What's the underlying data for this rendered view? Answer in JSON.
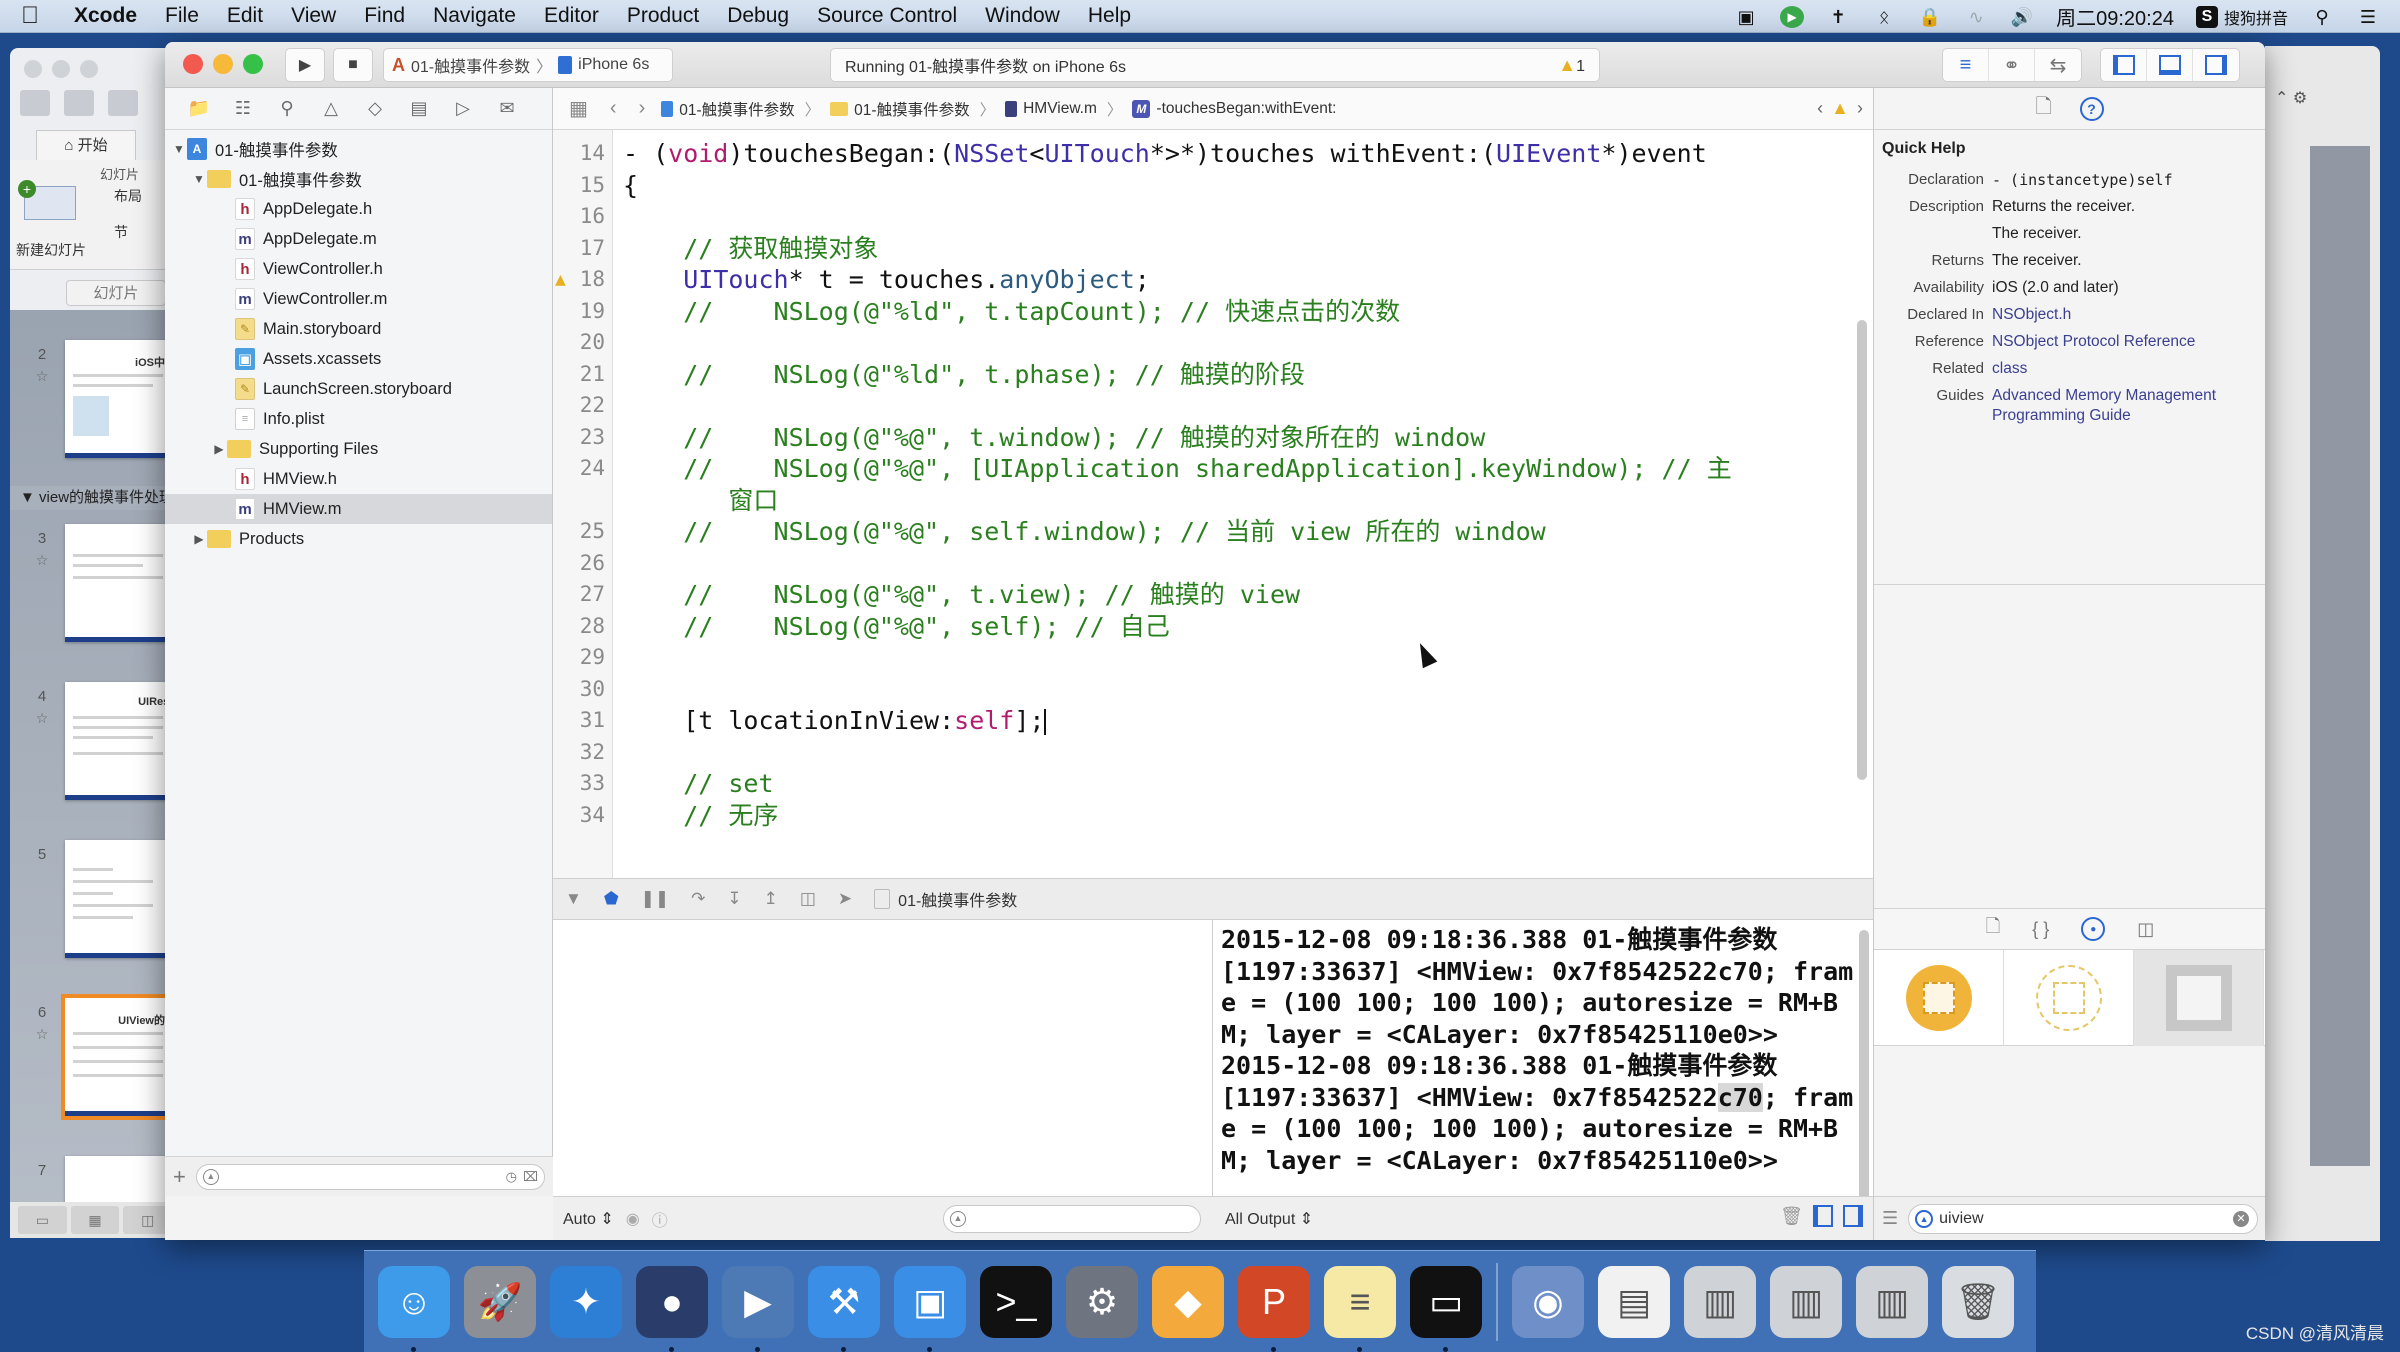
{
  "menubar": {
    "app_name": "Xcode",
    "items": [
      "File",
      "Edit",
      "View",
      "Find",
      "Navigate",
      "Editor",
      "Product",
      "Debug",
      "Source Control",
      "Window",
      "Help"
    ],
    "clock": "周二09:20:24",
    "input_method": "搜狗拼音",
    "input_method_badge": "S"
  },
  "background_presentation": {
    "home_tab": "开始",
    "ribbon_group": "幻灯片",
    "new_slide": "新建幻灯片",
    "layout": "布局",
    "section": "节",
    "slides_tab": "幻灯片",
    "section_header": "view的触摸事件处理",
    "slides": [
      {
        "number": "2",
        "title": "iOS中的"
      },
      {
        "number": "3",
        "title": ""
      },
      {
        "number": "4",
        "title": "UIResp"
      },
      {
        "number": "5",
        "title": ""
      },
      {
        "number": "6",
        "title": "UIView的触"
      },
      {
        "number": "7",
        "title": ""
      }
    ],
    "selected_slide": "6"
  },
  "toolbar": {
    "scheme": "01-触摸事件参数",
    "device": "iPhone 6s",
    "activity": "Running 01-触摸事件参数 on iPhone 6s",
    "warning_count": "1"
  },
  "navigator": {
    "project": "01-触摸事件参数",
    "group": "01-触摸事件参数",
    "files": [
      {
        "name": "AppDelegate.h",
        "type": "h"
      },
      {
        "name": "AppDelegate.m",
        "type": "m"
      },
      {
        "name": "ViewController.h",
        "type": "h"
      },
      {
        "name": "ViewController.m",
        "type": "m"
      },
      {
        "name": "Main.storyboard",
        "type": "storyboard"
      },
      {
        "name": "Assets.xcassets",
        "type": "assets"
      },
      {
        "name": "LaunchScreen.storyboard",
        "type": "storyboard"
      },
      {
        "name": "Info.plist",
        "type": "plist"
      },
      {
        "name": "Supporting Files",
        "type": "folder"
      },
      {
        "name": "HMView.h",
        "type": "h"
      },
      {
        "name": "HMView.m",
        "type": "m"
      }
    ],
    "products": "Products",
    "selected_file": "HMView.m"
  },
  "jumpbar": {
    "crumbs": [
      "01-触摸事件参数",
      "01-触摸事件参数",
      "HMView.m",
      "-touchesBegan:withEvent:"
    ],
    "method_badge": "M"
  },
  "editor": {
    "lines": [
      {
        "n": "14",
        "tokens": [
          [
            "p",
            "- ("
          ],
          [
            "kw",
            "void"
          ],
          [
            "p",
            ")touchesBegan:("
          ],
          [
            "type",
            "NSSet"
          ],
          [
            "p",
            "<"
          ],
          [
            "type",
            "UITouch"
          ],
          [
            "p",
            "*>*)touches withEvent:("
          ],
          [
            "type",
            "UIEvent"
          ],
          [
            "p",
            "*)event"
          ]
        ]
      },
      {
        "n": "15",
        "tokens": [
          [
            "p",
            "{"
          ]
        ]
      },
      {
        "n": "16",
        "tokens": []
      },
      {
        "n": "17",
        "tokens": [
          [
            "p",
            "    "
          ],
          [
            "c",
            "// 获取触摸对象"
          ]
        ]
      },
      {
        "n": "18",
        "warning": true,
        "tokens": [
          [
            "p",
            "    "
          ],
          [
            "type",
            "UITouch"
          ],
          [
            "p",
            "* t = touches."
          ],
          [
            "method",
            "anyObject"
          ],
          [
            "p",
            ";"
          ]
        ]
      },
      {
        "n": "19",
        "tokens": [
          [
            "p",
            "    "
          ],
          [
            "c",
            "//    NSLog(@\"%ld\", t.tapCount); // 快速点击的次数"
          ]
        ]
      },
      {
        "n": "20",
        "tokens": []
      },
      {
        "n": "21",
        "tokens": [
          [
            "p",
            "    "
          ],
          [
            "c",
            "//    NSLog(@\"%ld\", t.phase); // 触摸的阶段"
          ]
        ]
      },
      {
        "n": "22",
        "tokens": []
      },
      {
        "n": "23",
        "tokens": [
          [
            "p",
            "    "
          ],
          [
            "c",
            "//    NSLog(@\"%@\", t.window); // 触摸的对象所在的 window"
          ]
        ]
      },
      {
        "n": "24",
        "tokens": [
          [
            "p",
            "    "
          ],
          [
            "c",
            "//    NSLog(@\"%@\", [UIApplication sharedApplication].keyWindow); // 主"
          ]
        ]
      },
      {
        "n": "",
        "tokens": [
          [
            "p",
            "       "
          ],
          [
            "c",
            "窗口"
          ]
        ]
      },
      {
        "n": "25",
        "tokens": [
          [
            "p",
            "    "
          ],
          [
            "c",
            "//    NSLog(@\"%@\", self.window); // 当前 view 所在的 window"
          ]
        ]
      },
      {
        "n": "26",
        "tokens": []
      },
      {
        "n": "27",
        "tokens": [
          [
            "p",
            "    "
          ],
          [
            "c",
            "//    NSLog(@\"%@\", t.view); // 触摸的 view"
          ]
        ]
      },
      {
        "n": "28",
        "tokens": [
          [
            "p",
            "    "
          ],
          [
            "c",
            "//    NSLog(@\"%@\", self); // 自己"
          ]
        ]
      },
      {
        "n": "29",
        "tokens": []
      },
      {
        "n": "30",
        "tokens": []
      },
      {
        "n": "31",
        "caret": true,
        "tokens": [
          [
            "p",
            "    [t locationInView:"
          ],
          [
            "kw",
            "self"
          ],
          [
            "p",
            "];"
          ]
        ]
      },
      {
        "n": "32",
        "tokens": []
      },
      {
        "n": "33",
        "tokens": [
          [
            "p",
            "    "
          ],
          [
            "c",
            "// set"
          ]
        ]
      },
      {
        "n": "34",
        "tokens": [
          [
            "p",
            "    "
          ],
          [
            "c",
            "// 无序"
          ]
        ]
      }
    ]
  },
  "debugbar": {
    "process": "01-触摸事件参数"
  },
  "variables_bar": {
    "scope": "Auto"
  },
  "console": {
    "filter": "All Output",
    "entries": [
      {
        "timestamp": "2015-12-08 09:18:36.388",
        "process": "01-触摸事件参数",
        "pid": "[1197:33637]",
        "message_a": " <HMView: 0x7f8542522",
        "message_b": "c70",
        "message_c": "; frame = (100 100; 100 100); autoresize = RM+BM; layer = <CALayer: 0x7f85425110e0>>",
        "highlight": false
      },
      {
        "timestamp": "2015-12-08 09:18:36.388",
        "process": "01-触摸事件参数",
        "pid": "[1197:33637]",
        "message_a": " <HMView: 0x7f8542522",
        "message_b": "c70",
        "message_c": "; frame = (100 100; 100 100); autoresize = RM+BM; layer = <CALayer: 0x7f85425110e0>>",
        "highlight": true
      }
    ]
  },
  "quick_help": {
    "title": "Quick Help",
    "rows": [
      {
        "label": "Declaration",
        "value": "- (instancetype)self",
        "style": "mono"
      },
      {
        "label": "Description",
        "value": "Returns the receiver.",
        "style": ""
      },
      {
        "label": "",
        "value": "The receiver.",
        "style": ""
      },
      {
        "label": "Returns",
        "value": "The receiver.",
        "style": ""
      },
      {
        "label": "Availability",
        "value": "iOS (2.0 and later)",
        "style": ""
      },
      {
        "label": "Declared In",
        "value": "NSObject.h",
        "style": "link"
      },
      {
        "label": "Reference",
        "value": "NSObject Protocol Reference",
        "style": "link"
      },
      {
        "label": "Related",
        "value": "class",
        "style": "link"
      },
      {
        "label": "Guides",
        "value": "Advanced Memory Management Programming Guide",
        "style": "link"
      }
    ]
  },
  "library": {
    "items": [
      "Object",
      "External Object",
      "View"
    ],
    "search_value": "uiview"
  },
  "dock": {
    "apps": [
      {
        "name": "finder",
        "glyph": "☺",
        "bg": "#3d9be9",
        "running": true
      },
      {
        "name": "launchpad",
        "glyph": "🚀",
        "bg": "#8c8f96",
        "running": false
      },
      {
        "name": "safari",
        "glyph": "✦",
        "bg": "#2d7fd6",
        "running": false
      },
      {
        "name": "mouse-app",
        "glyph": "●",
        "bg": "#2a3c6a",
        "running": true
      },
      {
        "name": "video-app",
        "glyph": "▶",
        "bg": "#4d79b5",
        "running": true
      },
      {
        "name": "xcode",
        "glyph": "⚒",
        "bg": "#3a8ee6",
        "running": true
      },
      {
        "name": "simulator",
        "glyph": "▣",
        "bg": "#3a8ee6",
        "running": true
      },
      {
        "name": "terminal",
        "glyph": ">_",
        "bg": "#111111",
        "running": false
      },
      {
        "name": "system-preferences",
        "glyph": "⚙",
        "bg": "#6f7580",
        "running": false
      },
      {
        "name": "sketch",
        "glyph": "◆",
        "bg": "#f3a93b",
        "running": false
      },
      {
        "name": "powerpoint",
        "glyph": "P",
        "bg": "#d24726",
        "running": true
      },
      {
        "name": "notes",
        "glyph": "≡",
        "bg": "#f6e9a6",
        "running": true
      },
      {
        "name": "console",
        "glyph": "▭",
        "bg": "#111111",
        "running": true
      }
    ],
    "right_items": [
      {
        "name": "screen-recorder",
        "glyph": "◉",
        "bg": "#6e8fc8"
      },
      {
        "name": "document-preview",
        "glyph": "▤",
        "bg": "#f1f1f1"
      },
      {
        "name": "window-preview-1",
        "glyph": "▥",
        "bg": "#cfd3d8"
      },
      {
        "name": "window-preview-2",
        "glyph": "▥",
        "bg": "#cfd3d8"
      },
      {
        "name": "window-preview-3",
        "glyph": "▥",
        "bg": "#cfd3d8"
      },
      {
        "name": "trash",
        "glyph": "🗑",
        "bg": "#d9dde2"
      }
    ]
  },
  "watermark": "CSDN @清风清晨",
  "colors": {
    "accent": "#2a67d1",
    "comment": "#2a7f1e",
    "keyword": "#b21c6f",
    "type": "#3d2fa8",
    "warning": "#e8b021"
  }
}
